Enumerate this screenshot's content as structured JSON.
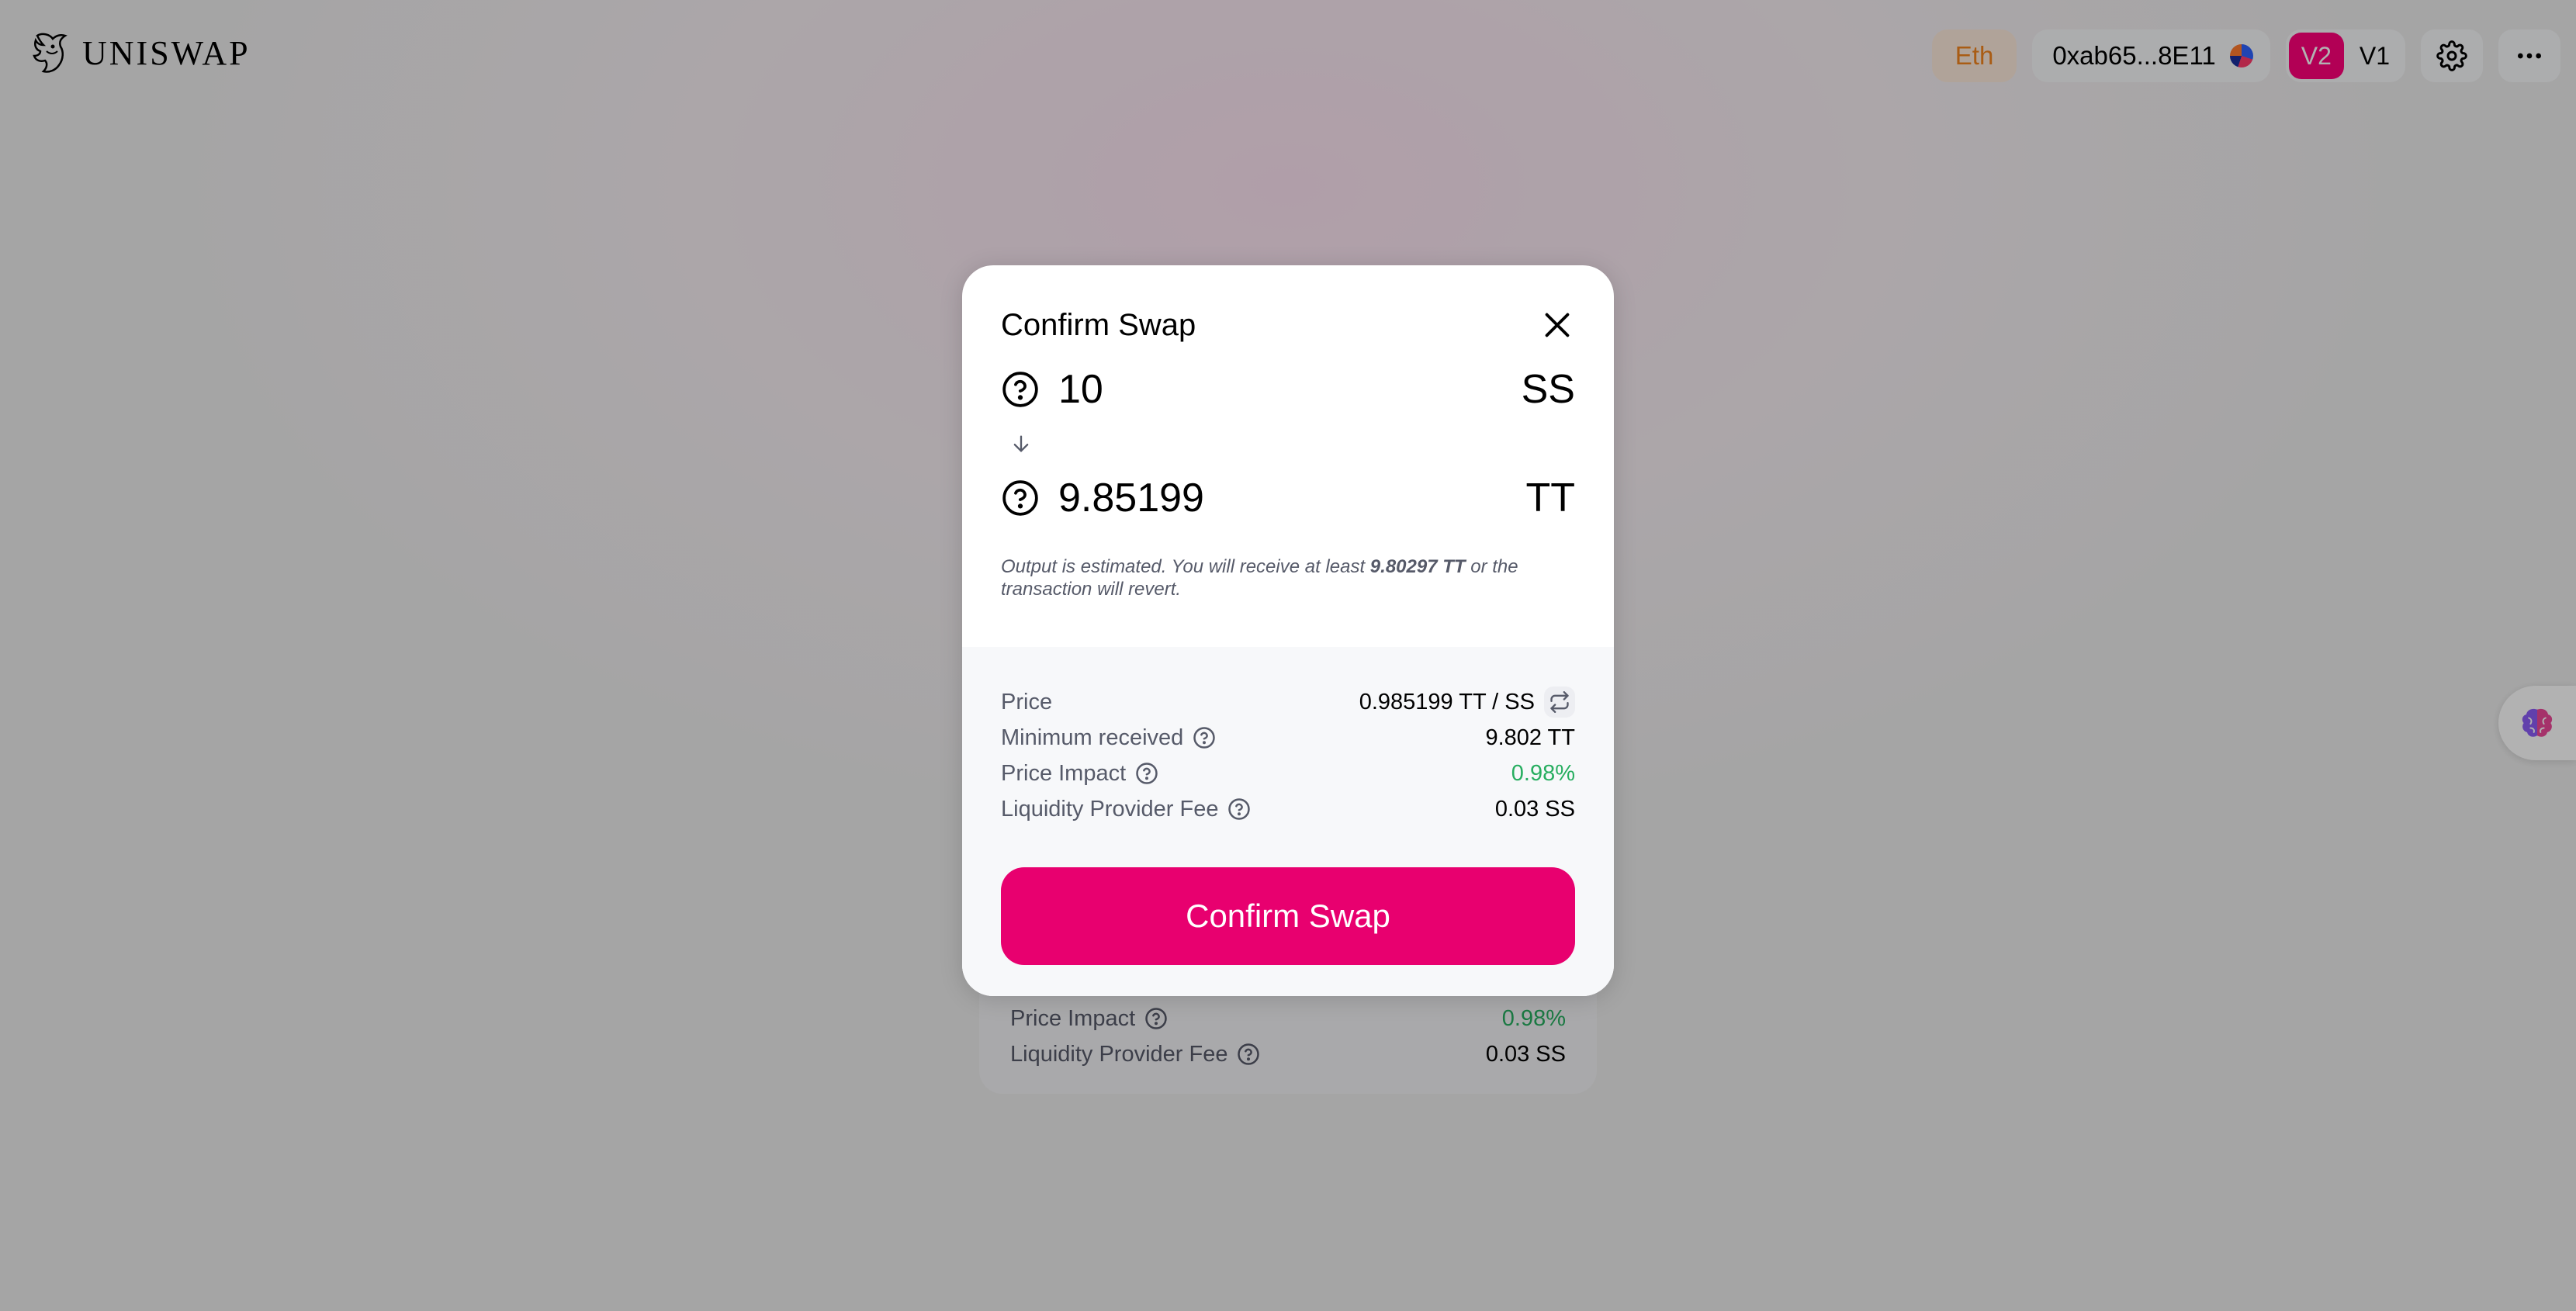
{
  "header": {
    "logo_text": "UNISWAP",
    "network_label": "Eth",
    "account_label": "0xab65...8E11",
    "versions": [
      "V2",
      "V1"
    ],
    "active_version": "V2",
    "icons": {
      "settings": "gear-icon",
      "more": "more-dots-icon",
      "logo": "unicorn-logo-icon"
    }
  },
  "background_details": {
    "rows": [
      {
        "label": "Price Impact",
        "value": "0.98%"
      },
      {
        "label": "Liquidity Provider Fee",
        "value": "0.03 SS"
      }
    ]
  },
  "modal": {
    "title": "Confirm Swap",
    "input": {
      "amount": "10",
      "symbol": "SS"
    },
    "output": {
      "amount": "9.85199",
      "symbol": "TT"
    },
    "estimate": {
      "prefix": "Output is estimated. You will receive at least ",
      "highlight": "9.80297 TT",
      "suffix": " or the transaction will revert."
    },
    "details": {
      "price_label": "Price",
      "price_value": "0.985199 TT / SS",
      "min_received_label": "Minimum received",
      "min_received_value": "9.802 TT",
      "price_impact_label": "Price Impact",
      "price_impact_value": "0.98%",
      "lp_fee_label": "Liquidity Provider Fee",
      "lp_fee_value": "0.03 SS"
    },
    "confirm_button_label": "Confirm Swap"
  },
  "colors": {
    "accent": "#e8006f",
    "version_active": "#ff007a",
    "network_text": "#f3841e",
    "positive": "#27ae60",
    "muted_text": "#565a69"
  }
}
